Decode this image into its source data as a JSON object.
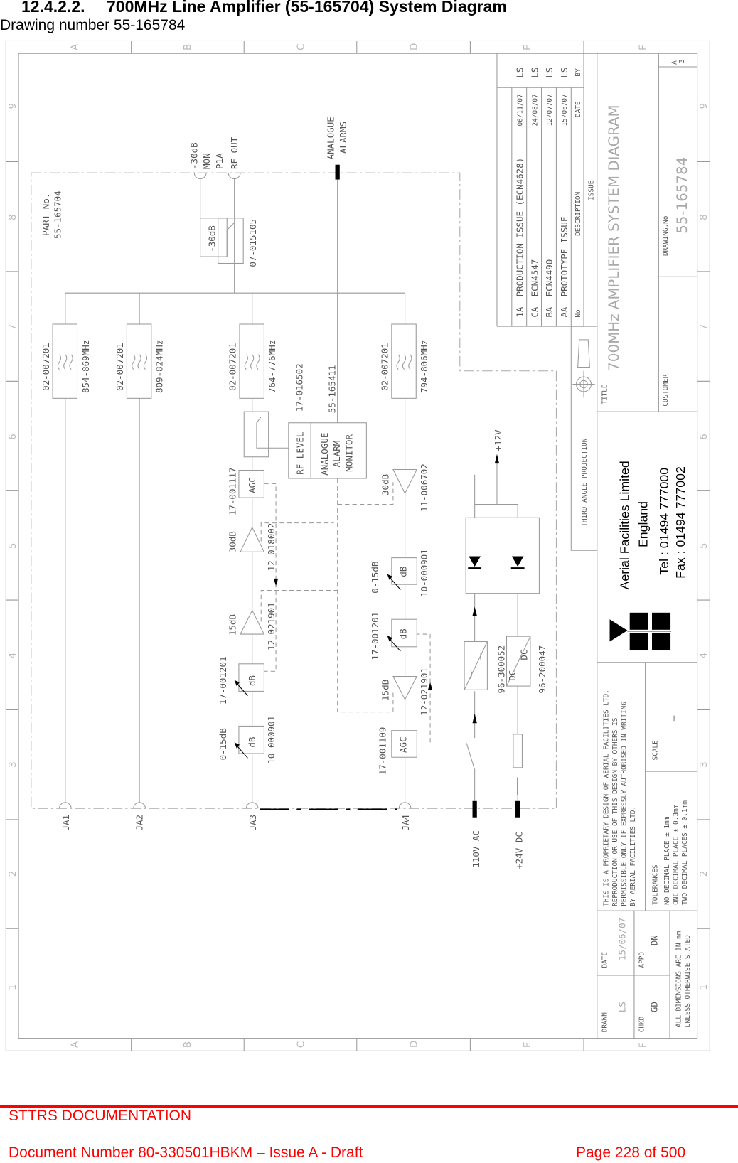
{
  "header": {
    "section": "12.4.2.2.",
    "title": "700MHz Line Amplifier (55-165704) System Diagram",
    "subtitle": "Drawing number 55-165784"
  },
  "footer": {
    "org": "STTRS DOCUMENTATION",
    "document": "Document Number 80-330501HBKM – Issue A - Draft",
    "page": "Page 228 of 500",
    "accent_color": "#ff0000"
  },
  "drawing": {
    "grid": {
      "columns": [
        "A",
        "B",
        "C",
        "D",
        "E",
        "F"
      ],
      "rows": [
        "1",
        "2",
        "3",
        "4",
        "5",
        "6",
        "7",
        "8",
        "9"
      ]
    },
    "part": {
      "label": "PART No.",
      "number": "55-165704"
    },
    "top_ports": {
      "mon": [
        "-30dB",
        "MON",
        "P1A"
      ],
      "rf_out": "RF OUT",
      "alarms": [
        "ANALOGUE",
        "ALARMS"
      ]
    },
    "coupler_out": {
      "value": "-30dB",
      "part": "07-015105"
    },
    "filters": [
      {
        "part": "02-007201",
        "band": "854-869MHz"
      },
      {
        "part": "02-007201",
        "band": "809-824MHz"
      },
      {
        "part": "02-007201",
        "band": "764-776MHz"
      },
      {
        "part": "02-007201",
        "band": "794-806MHz"
      }
    ],
    "monitor": {
      "coupler_part": "17-016502",
      "part": "55-165411",
      "rf_level": "RF LEVEL",
      "lines": [
        "ANALOGUE",
        "ALARM",
        "MONITOR"
      ]
    },
    "chain_ja3": {
      "agc_part": "17-001117",
      "agc": "AGC",
      "amp1_gain": "30dB",
      "amp1_part": "12-018002",
      "amp2_gain": "15dB",
      "amp2_part": "12-021901",
      "att1_part": "17-001201",
      "att1": "dB",
      "att2_range": "0-15dB",
      "att2": "dB",
      "att2_part": "10-000901"
    },
    "chain_ja4": {
      "amp1_gain": "30dB",
      "amp1_part": "11-006702",
      "att1_range": "0-15dB",
      "att1": "dB",
      "att1_part": "10-000901",
      "att2_part": "17-001201",
      "att2": "dB",
      "amp2_gain": "15dB",
      "amp2_part": "12-021901",
      "agc_part": "17-001109",
      "agc": "AGC"
    },
    "ports": [
      "JA1",
      "JA2",
      "JA3",
      "JA4"
    ],
    "power": {
      "ac_in": "110V AC",
      "dc_in": "+24V DC",
      "rail": "+12V",
      "psu_part": "96-300052",
      "dcdc_part": "96-200047",
      "dcdc_in": "DC",
      "dcdc_out": "DC"
    }
  },
  "revisions": {
    "headers": {
      "no": "No",
      "description": "DESCRIPTION",
      "date": "DATE",
      "by": "BY",
      "issue": "ISSUE"
    },
    "rows": [
      {
        "no": "1A",
        "description": "PRODUCTION ISSUE (ECN4628)",
        "date": "06/11/07",
        "by": "LS"
      },
      {
        "no": "CA",
        "description": "ECN4547",
        "date": "24/08/07",
        "by": "LS"
      },
      {
        "no": "BA",
        "description": "ECN4490",
        "date": "12/07/07",
        "by": "LS"
      },
      {
        "no": "AA",
        "description": "PROTOTYPE ISSUE",
        "date": "15/06/07",
        "by": "LS"
      }
    ]
  },
  "title_block": {
    "sheet_size": [
      "A",
      "3"
    ],
    "title_label": "TITLE",
    "title": "700MHz AMPLIFIER SYSTEM DIAGRAM",
    "customer_label": "CUSTOMER",
    "drawing_no_label": "DRAWING.No",
    "drawing_no": "55-165784",
    "projection": "THIRD ANGLE PROJECTION",
    "company": {
      "name": "Aerial Facilities Limited",
      "country": "England",
      "tel": "Tel : 01494 777000",
      "fax": "Fax : 01494 777002"
    },
    "disclaimer": [
      "THIS IS A PROPRIETARY DESIGN OF AERIAL FACILITIES LTD.",
      "REPRODUCTION OR USE OF THIS DESIGN BY OTHERS IS",
      "PERMISSIBLE ONLY IF EXPRESSLY AUTHORISED IN WRITING",
      "BY AERIAL FACILITIES LTD."
    ],
    "scale_label": "SCALE",
    "scale": "—",
    "tolerances_label": "TOLERANCES",
    "tolerances": [
      "NO DECIMAL PLACE ± 1mm",
      "ONE DECIMAL PLACE ± 0.3mm",
      "TWO DECIMAL PLACES ± 0.1mm"
    ],
    "drawn_label": "DRAWN",
    "drawn": "LS",
    "date_label": "DATE",
    "date": "15/06/07",
    "chkd_label": "CHKD",
    "chkd": "GD",
    "appd_label": "APPD",
    "appd": "DN",
    "units_note": [
      "ALL DIMENSIONS ARE IN mm",
      "UNLESS OTHERWISE STATED"
    ]
  }
}
